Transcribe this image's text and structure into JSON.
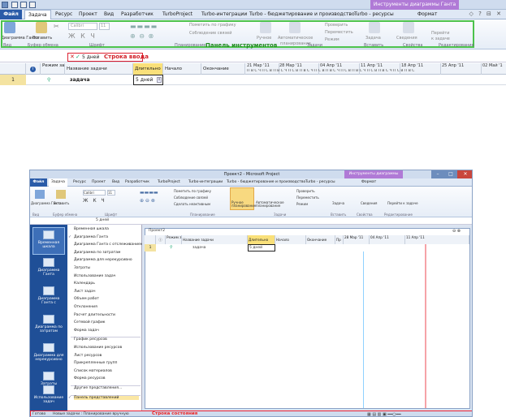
{
  "top": {
    "context_tab": "Инструменты диаграммы Ганта",
    "tabs": [
      "Файл",
      "Задача",
      "Ресурс",
      "Проект",
      "Вид",
      "Разработчик",
      "TurboProject",
      "Turbo-интеграции",
      "Turbo - бюджетирование и производство",
      "Turbo - ресурсы",
      "Формат"
    ],
    "ribbon": {
      "gantt_btn": "Диаграмма Ганта",
      "paste_btn": "Вставить",
      "font_name": "Calibri",
      "font_size": "11",
      "mark_on_track": "Пометить по графику",
      "respect_links": "Соблюдение связей",
      "manual": "Ручное",
      "auto": "Автоматическое",
      "auto2": "планирование",
      "check": "Проверить",
      "move": "Переместить",
      "mode": "Режим",
      "task": "Задача",
      "details": "Сведения",
      "goto1": "Перейти",
      "goto2": "к задаче",
      "groups": [
        "Вид",
        "Буфер обмена",
        "Шрифт",
        "Планирование",
        "Задачи",
        "Вставить",
        "Свойства",
        "Редактирование"
      ]
    },
    "panel_label": "Панель инструментов",
    "entry_value": "5 дней",
    "entry_label": "Строка ввода",
    "columns": [
      "Режим задачи",
      "Название задачи",
      "Длительно",
      "Начало",
      "Окончание"
    ],
    "timeline_weeks": [
      "21 Мар '11",
      "28 Мар '11",
      "04 Апр '11",
      "11 Апр '11",
      "18 Апр '11",
      "25 Апр '11",
      "02 Май '1"
    ],
    "timeline_days": "П В С Ч П С В П В С Ч П С В П В С Ч П С В П В С Ч П С В П В С Ч П С В П В С Ч П С В П В С",
    "row": {
      "num": "1",
      "name": "задача",
      "duration": "5 дней"
    }
  },
  "bottom": {
    "title": "Проект2 - Microsoft Project",
    "context_tab": "Инструменты диаграммы Ганта",
    "tabs": [
      "Файл",
      "Задача",
      "Ресурс",
      "Проект",
      "Вид",
      "Разработчик",
      "TurboProject",
      "Turbo-интеграции",
      "Turbo - бюджетирование и производство",
      "Turbo - ресурсы",
      "Формат"
    ],
    "ribbon": {
      "gantt": "Диаграмма Ганта",
      "paste": "Вставить",
      "font": "Calibri",
      "size": "11",
      "mark": "Пометить по графику",
      "respect": "Соблюдение связей",
      "inactive": "Сделать неактивным",
      "manual": "Ручное планирование",
      "auto": "Автоматическое планирование",
      "check": "Проверить",
      "move": "Переместить",
      "mode": "Режим",
      "task": "Задача",
      "details": "Сведения",
      "goto": "Перейти к задаче",
      "groups": [
        "Вид",
        "Буфер обмена",
        "Шрифт",
        "Планирование",
        "Задачи",
        "Вставить",
        "Свойства",
        "Редактирование"
      ]
    },
    "entry_value": "5 дней",
    "views": [
      "Временная шкала",
      "Диаграмма Ганта",
      "Диаграмма Ганта с",
      "Диаграмма по затратам",
      "Диаграмма для нерекурсивно",
      "Затраты",
      "Использование задач"
    ],
    "menu_items": [
      "Временная шкала",
      "Диаграмма Ганта",
      "Диаграмма Ганта с отслеживанием",
      "Диаграмма по затратам",
      "Диаграмма для нерекурсивно",
      "Затраты",
      "Использование задач",
      "Календарь",
      "Лист задач",
      "Объем работ",
      "Отклонения",
      "Расчет длительности",
      "Сетевой график",
      "Форма задач",
      "График ресурсов",
      "Использование ресурсов",
      "Лист ресурсов",
      "Прикрепленные групп",
      "Список материалов",
      "Форма ресурсов",
      "Другие представления...",
      "Панель представлений"
    ],
    "project_window": "Проект2",
    "columns": [
      "Режим задачи",
      "Название задачи",
      "Длительно",
      "Начало",
      "Окончание",
      "Пр"
    ],
    "weeks": [
      "28 Мар '11",
      "04 Апр '11",
      "11 Апр '11"
    ],
    "row": {
      "num": "1",
      "name": "задача",
      "duration": "5 дней"
    },
    "status": {
      "ready": "Готово",
      "new_tasks": "Новые задачи : Планирование вручную",
      "label": "Строка состояния"
    }
  }
}
